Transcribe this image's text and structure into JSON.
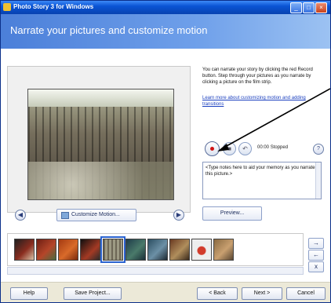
{
  "window": {
    "title": "Photo Story 3 for Windows",
    "minimize": "_",
    "maximize": "□",
    "close": "×"
  },
  "header": {
    "title": "Narrate your pictures and customize motion"
  },
  "photo_nav": {
    "prev": "◀",
    "next": "▶"
  },
  "customize_motion": {
    "label": "Customize Motion..."
  },
  "instructions": {
    "text": "You can narrate your story by clicking the red Record button. Step through your pictures as you narrate by clicking a picture on the film strip."
  },
  "learn_link": {
    "text": "Learn more about customizing motion and adding transitions"
  },
  "recording": {
    "record_label": "Record",
    "stop_symbol": "■",
    "undo_symbol": "↶",
    "time": "00:00",
    "status": "Stopped",
    "help": "?"
  },
  "narration": {
    "placeholder": "<Type notes here to aid your memory as you narrate this picture.>"
  },
  "preview_button": "Preview...",
  "filmstrip": {
    "thumbnails": [
      "thumb-1",
      "thumb-2",
      "thumb-3",
      "thumb-4",
      "thumb-5",
      "thumb-6",
      "thumb-7",
      "thumb-8",
      "thumb-9",
      "thumb-10"
    ],
    "selected_index": 4
  },
  "film_controls": {
    "right": "→",
    "left": "←",
    "delete": "x"
  },
  "footer": {
    "help": "Help",
    "save": "Save Project...",
    "back": "< Back",
    "next": "Next >",
    "cancel": "Cancel"
  }
}
